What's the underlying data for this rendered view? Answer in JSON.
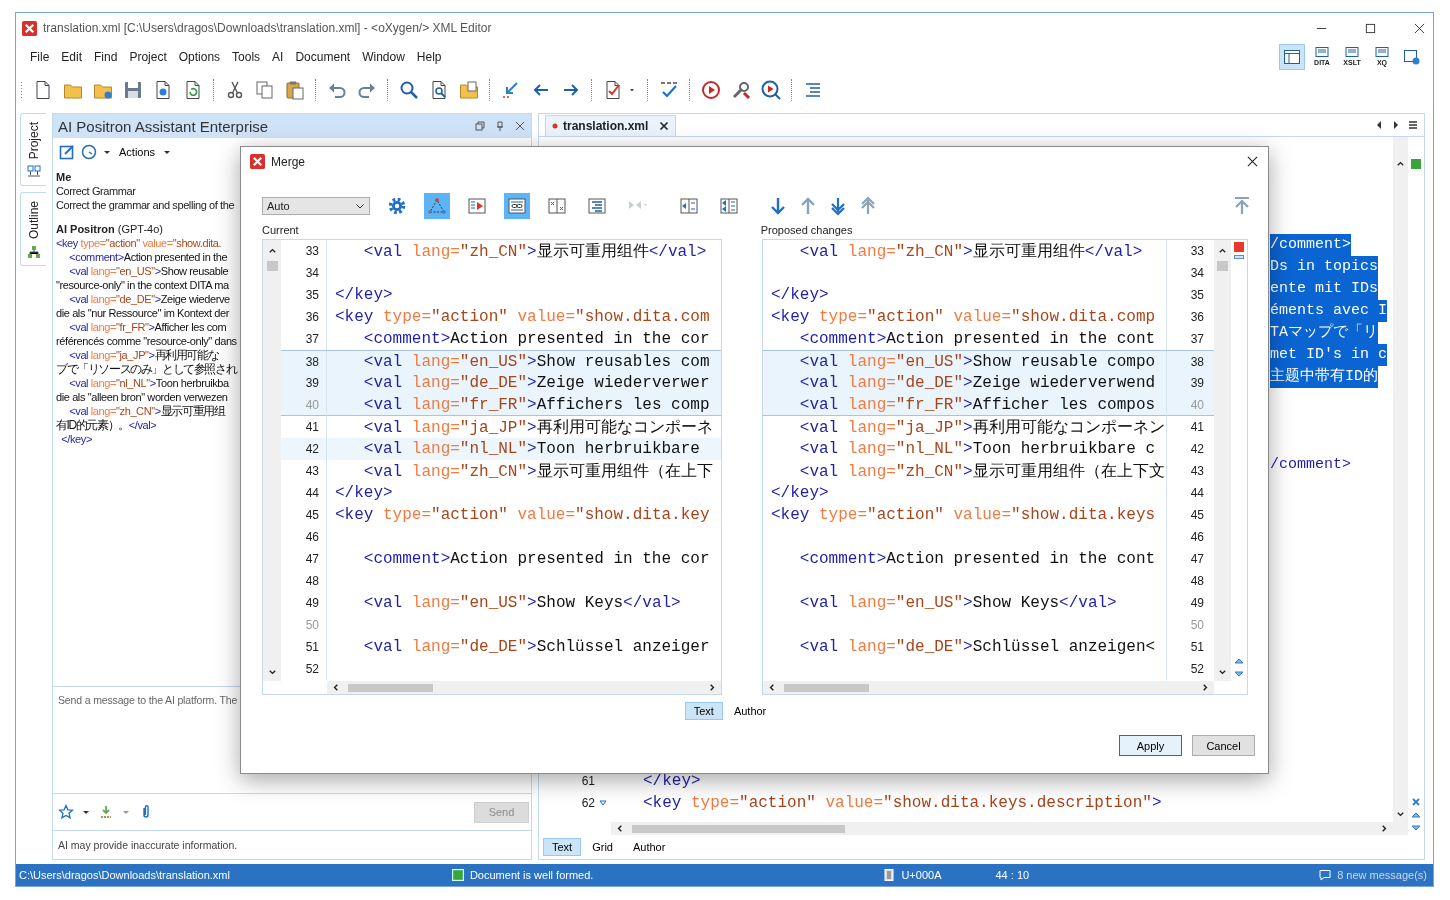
{
  "window": {
    "title": "translation.xml [C:\\Users\\dragos\\Downloads\\translation.xml] - <oXygen/> XML Editor"
  },
  "menu": [
    "File",
    "Edit",
    "Find",
    "Project",
    "Options",
    "Tools",
    "AI",
    "Document",
    "Window",
    "Help"
  ],
  "perspectives": [
    {
      "selected": true
    },
    {
      "label": "DITA",
      "selected": false
    },
    {
      "label": "XSLT",
      "selected": false
    },
    {
      "label": "XQ",
      "selected": false
    },
    {
      "selected": false
    }
  ],
  "side_tabs": [
    "Project",
    "Outline"
  ],
  "assistant": {
    "title": "AI Positron Assistant Enterprise",
    "actions_label": "Actions",
    "user_author": "Me",
    "user_lines": [
      "Correct Grammar",
      "Correct the grammar and spelling of the"
    ],
    "ai_author": "**AI Positron** (GPT-4o)",
    "ai_lines": [
      "<key type=\"action\" value=\"show.dita.",
      "     <comment>Action presented in the",
      "     <val lang=\"en_US\">Show reusable",
      "\"resource-only\" in the context DITA ma",
      "     <val lang=\"de_DE\">Zeige wiederve",
      "die als \"nur Ressource\" im Kontext der",
      "     <val lang=\"fr_FR\">Afficher les com",
      "référencés comme \"resource-only\" dans",
      "     <val lang=\"ja_JP\">再利用可能な",
      "ブで「リソースのみ」として参照され",
      "     <val lang=\"nl_NL\">Toon herbruikba",
      "die als \"alleen bron\" worden verwezen",
      "     <val lang=\"zh_CN\">显示可重用组",
      "有ID的元素）。</val>",
      "  </key>"
    ],
    "input": {
      "placeholder": "Send a message to the AI platform. The"
    },
    "send": {
      "label": "Send",
      "disabled": true
    },
    "disclaimer": "AI may provide inaccurate information."
  },
  "editor": {
    "tab": {
      "label": "translation.xml",
      "modified": true
    },
    "fragments": [
      {
        "text": "/comment>",
        "selected": true
      },
      {
        "text": "Ds in topics",
        "selected": true
      },
      {
        "text": "ente mit IDs",
        "selected": true
      },
      {
        "text": "éments avec I",
        "selected": true
      },
      {
        "text": "TAマップで「リ",
        "selected": true
      },
      {
        "text": "met ID's in c",
        "selected": true
      },
      {
        "text": "主题中带有ID的",
        "selected": true
      },
      {
        "text": "/comment>",
        "selected": false
      }
    ],
    "lines": [
      {
        "number": "61",
        "text": "</key>",
        "foldable": false
      },
      {
        "number": "62",
        "text": "<key type=\"action\" value=\"show.dita.keys.description\">",
        "foldable": true
      }
    ],
    "modes": [
      {
        "label": "Text",
        "selected": true
      },
      {
        "label": "Grid",
        "selected": false
      },
      {
        "label": "Author",
        "selected": false
      }
    ],
    "well_formed": true
  },
  "merge": {
    "title": "Merge",
    "mode": "Auto",
    "tools": [
      {
        "selected": false,
        "disabled": false
      },
      {
        "selected": true,
        "disabled": false
      },
      {
        "selected": false,
        "disabled": false
      },
      {
        "selected": true,
        "disabled": false
      },
      {
        "selected": false,
        "disabled": false
      },
      {
        "selected": false,
        "disabled": false
      },
      {
        "selected": false,
        "disabled": true
      },
      {
        "selected": false,
        "disabled": false
      },
      {
        "selected": false,
        "disabled": false
      }
    ],
    "navigation": [
      {
        "disabled": false
      },
      {
        "disabled": true
      },
      {
        "disabled": false
      },
      {
        "disabled": true
      },
      {
        "disabled": true
      }
    ],
    "current_label": "Current",
    "proposed_label": "Proposed changes",
    "current": [
      {
        "number": "33",
        "text": "   <val lang=\"zh_CN\">显示可重用组件</val>",
        "changed": false,
        "current": false,
        "dim": false
      },
      {
        "number": "34",
        "changed": false,
        "current": false,
        "dim": false
      },
      {
        "number": "35",
        "text": "</key>",
        "changed": false,
        "current": false,
        "dim": false
      },
      {
        "number": "36",
        "text": "<key type=\"action\" value=\"show.dita.com",
        "changed": false,
        "current": false,
        "dim": false
      },
      {
        "number": "37",
        "text": "   <comment>Action presented in the cor",
        "changed": false,
        "current": false,
        "dim": false
      },
      {
        "number": "38",
        "text": "   <val lang=\"en_US\">Show reusables com",
        "changed": true,
        "current": false,
        "dim": false
      },
      {
        "number": "39",
        "text": "   <val lang=\"de_DE\">Zeige wiederverwer",
        "changed": true,
        "current": false,
        "dim": false
      },
      {
        "number": "40",
        "text": "   <val lang=\"fr_FR\">Affichers les comp",
        "changed": true,
        "current": false,
        "dim": true
      },
      {
        "number": "41",
        "text": "   <val lang=\"ja_JP\">再利用可能なコンポーネ",
        "changed": false,
        "current": false,
        "dim": false
      },
      {
        "number": "42",
        "text": "   <val lang=\"nl_NL\">Toon herbruikbare",
        "changed": false,
        "current": true,
        "dim": false
      },
      {
        "number": "43",
        "text": "   <val lang=\"zh_CN\">显示可重用组件（在上下",
        "changed": false,
        "current": false,
        "dim": false
      },
      {
        "number": "44",
        "text": "</key>",
        "changed": false,
        "current": false,
        "dim": false
      },
      {
        "number": "45",
        "text": "<key type=\"action\" value=\"show.dita.key",
        "changed": false,
        "current": false,
        "dim": false
      },
      {
        "number": "46",
        "changed": false,
        "current": false,
        "dim": false
      },
      {
        "number": "47",
        "text": "   <comment>Action presented in the cor",
        "changed": false,
        "current": false,
        "dim": false
      },
      {
        "number": "48",
        "changed": false,
        "current": false,
        "dim": false
      },
      {
        "number": "49",
        "text": "   <val lang=\"en_US\">Show Keys</val>",
        "changed": false,
        "current": false,
        "dim": false
      },
      {
        "number": "50",
        "changed": false,
        "current": false,
        "dim": true
      },
      {
        "number": "51",
        "text": "   <val lang=\"de_DE\">Schlüssel anzeiger",
        "changed": false,
        "current": false,
        "dim": false
      },
      {
        "number": "52",
        "changed": false,
        "current": false,
        "dim": false
      }
    ],
    "proposed": [
      {
        "number": "33",
        "text": "   <val lang=\"zh_CN\">显示可重用组件</val>",
        "changed": false,
        "dim": false
      },
      {
        "number": "34",
        "changed": false,
        "dim": false
      },
      {
        "number": "35",
        "text": "</key>",
        "changed": false,
        "dim": false
      },
      {
        "number": "36",
        "text": "<key type=\"action\" value=\"show.dita.comp",
        "changed": false,
        "dim": false
      },
      {
        "number": "37",
        "text": "   <comment>Action presented in the cont",
        "changed": false,
        "dim": false
      },
      {
        "number": "38",
        "text": "   <val lang=\"en_US\">Show reusable compo",
        "changed": true,
        "dim": false
      },
      {
        "number": "39",
        "text": "   <val lang=\"de_DE\">Zeige wiederverwend",
        "changed": true,
        "dim": false
      },
      {
        "number": "40",
        "text": "   <val lang=\"fr_FR\">Afficher les compos",
        "changed": true,
        "dim": true
      },
      {
        "number": "41",
        "text": "   <val lang=\"ja_JP\">再利用可能なコンポーネン",
        "changed": false,
        "dim": false
      },
      {
        "number": "42",
        "text": "   <val lang=\"nl_NL\">Toon herbruikbare c",
        "changed": false,
        "dim": false
      },
      {
        "number": "43",
        "text": "   <val lang=\"zh_CN\">显示可重用组件（在上下文",
        "changed": false,
        "dim": false
      },
      {
        "number": "44",
        "text": "</key>",
        "changed": false,
        "dim": false
      },
      {
        "number": "45",
        "text": "<key type=\"action\" value=\"show.dita.keys",
        "changed": false,
        "dim": false
      },
      {
        "number": "46",
        "changed": false,
        "dim": false
      },
      {
        "number": "47",
        "text": "   <comment>Action presented in the cont",
        "changed": false,
        "dim": false
      },
      {
        "number": "48",
        "changed": false,
        "dim": false
      },
      {
        "number": "49",
        "text": "   <val lang=\"en_US\">Show Keys</val>",
        "changed": false,
        "dim": false
      },
      {
        "number": "50",
        "changed": false,
        "dim": true
      },
      {
        "number": "51",
        "text": "   <val lang=\"de_DE\">Schlüssel anzeigen<",
        "changed": false,
        "dim": false
      },
      {
        "number": "52",
        "changed": false,
        "dim": false
      }
    ],
    "modes": [
      {
        "label": "Text",
        "selected": true
      },
      {
        "label": "Author",
        "selected": false
      }
    ],
    "buttons": [
      {
        "label": "Apply",
        "default": true
      },
      {
        "label": "Cancel",
        "default": false
      }
    ]
  },
  "status_bar": {
    "path": "C:\\Users\\dragos\\Downloads\\translation.xml",
    "validity": "Document is well formed.",
    "encoding": "U+000A",
    "position": "44 : 10",
    "messages": "8 new message(s)"
  }
}
